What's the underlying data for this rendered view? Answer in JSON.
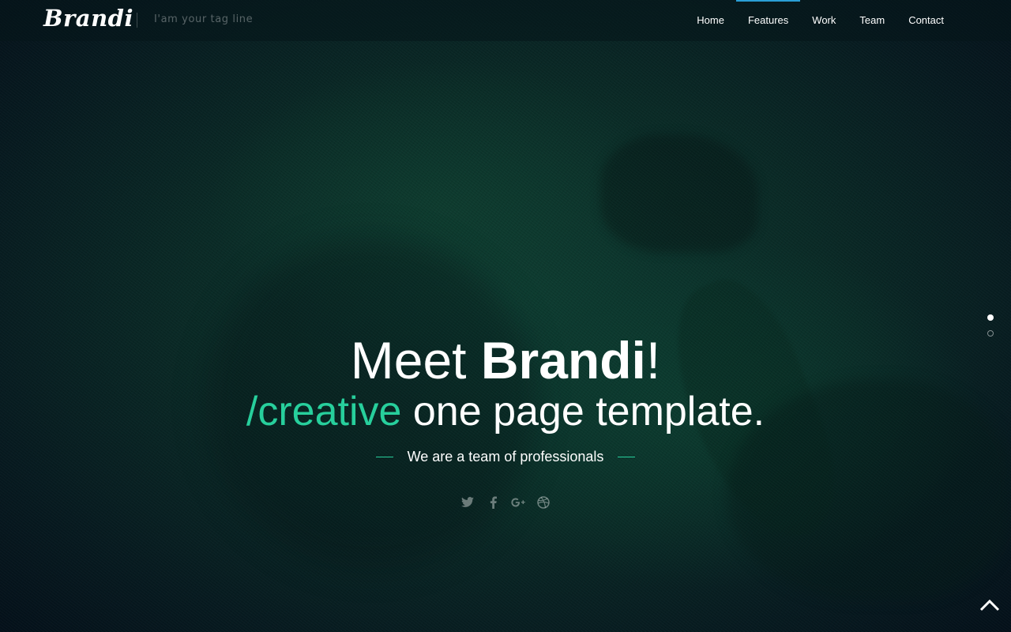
{
  "header": {
    "logo": "Brandi",
    "tagline": "I'am your tag line",
    "nav": [
      {
        "label": "Home",
        "active": false
      },
      {
        "label": "Features",
        "active": true
      },
      {
        "label": "Work",
        "active": false
      },
      {
        "label": "Team",
        "active": false
      },
      {
        "label": "Contact",
        "active": false
      }
    ]
  },
  "hero": {
    "headline_prefix": "Meet ",
    "headline_brand": "Brandi",
    "headline_suffix": "!",
    "subline_accent": "/creative",
    "subline_rest": " one page template.",
    "tagline": "We are a team of professionals",
    "social": [
      {
        "icon": "twitter-icon",
        "glyph": "ṫ"
      },
      {
        "icon": "facebook-icon",
        "glyph": "f"
      },
      {
        "icon": "google-plus-icon",
        "glyph": "g+"
      },
      {
        "icon": "dribbble-icon",
        "glyph": "⊕"
      }
    ]
  },
  "slider": {
    "slides": 2,
    "current": 1
  },
  "colors": {
    "accent": "#27cf9c",
    "nav_active_bar": "#2a9fd6",
    "background": "#0a2a26"
  }
}
